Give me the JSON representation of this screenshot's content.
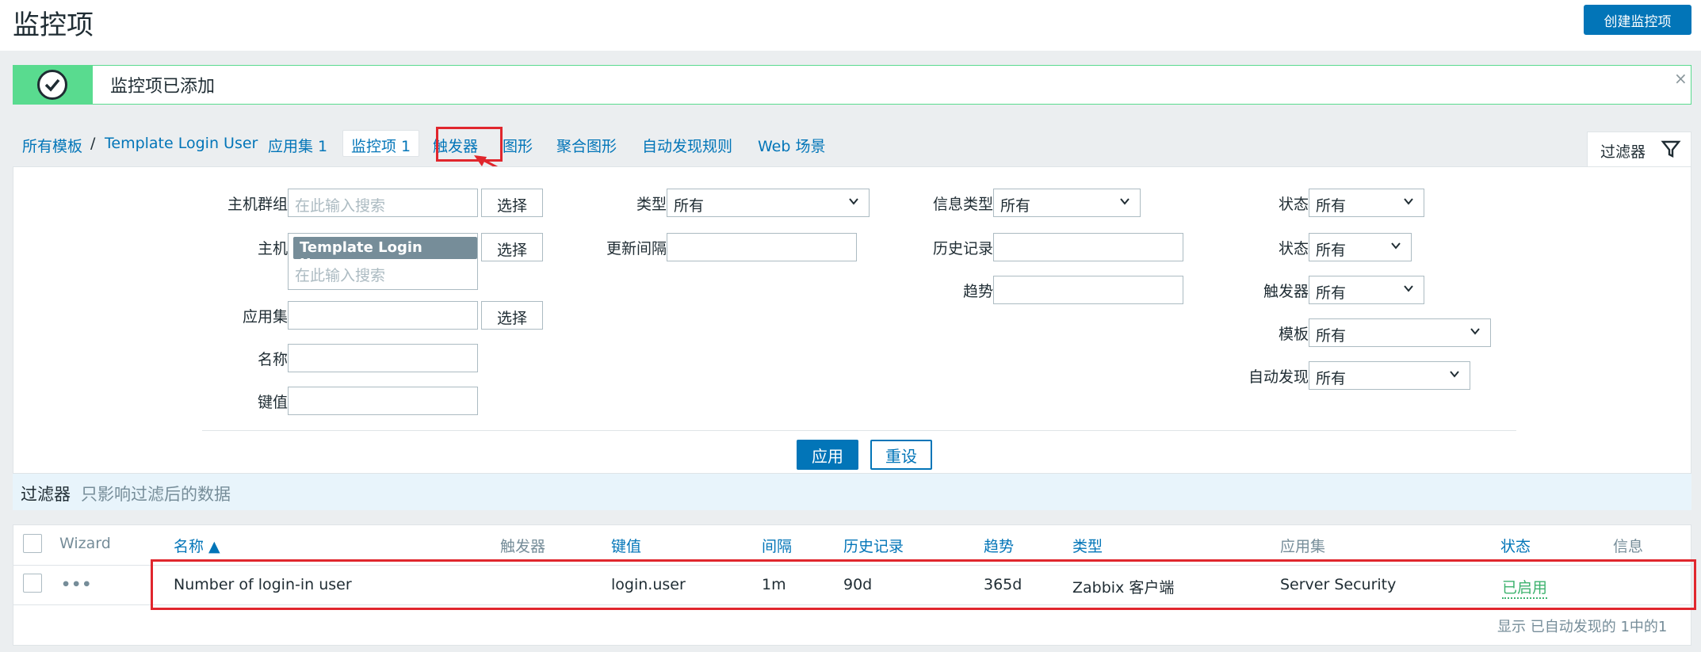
{
  "header": {
    "title": "监控项",
    "create_label": "创建监控项"
  },
  "message": {
    "text": "监控项已添加",
    "close": "×"
  },
  "nav": {
    "breadcrumb_all": "所有模板",
    "sep": "/",
    "template": "Template Login User",
    "tabs": [
      {
        "label": "应用集 1"
      },
      {
        "label": "监控项 1"
      },
      {
        "label": "触发器"
      },
      {
        "label": "图形"
      },
      {
        "label": "聚合图形"
      },
      {
        "label": "自动发现规则"
      },
      {
        "label": "Web 场景"
      }
    ],
    "filter_label": "过滤器"
  },
  "filter": {
    "hostgroup_label": "主机群组",
    "host_label": "主机",
    "app_label": "应用集",
    "name_label": "名称",
    "key_label": "键值",
    "placeholder": "在此输入搜索",
    "select_label": "选择",
    "host_chip": "Template Login User",
    "chip_remove": "✕",
    "type_label": "类型",
    "interval_label": "更新间隔",
    "infotype_label": "信息类型",
    "history_label": "历史记录",
    "trends_label": "趋势",
    "state_label": "状态",
    "status_label": "状态",
    "triggers_label": "触发器",
    "template_label": "模板",
    "discovery_label": "自动发现",
    "all": "所有",
    "apply_label": "应用",
    "reset_label": "重设",
    "note_prefix": "过滤器",
    "note_text": "只影响过滤后的数据"
  },
  "table": {
    "columns": [
      "Wizard",
      "名称 ▲",
      "触发器",
      "键值",
      "间隔",
      "历史记录",
      "趋势",
      "类型",
      "应用集",
      "状态",
      "信息"
    ],
    "rows": [
      {
        "wizard": "•••",
        "name": "Number of login-in user",
        "triggers": "",
        "key": "login.user",
        "interval": "1m",
        "history": "90d",
        "trends": "365d",
        "type": "Zabbix 客户端",
        "application": "Server Security",
        "status": "已启用",
        "info": ""
      }
    ],
    "footer": "显示 已自动发现的 1中的1"
  },
  "colors": {
    "accent": "#0275b8",
    "success": "#59db8f",
    "highlight": "#e0262d",
    "enabled": "#3db26e"
  }
}
